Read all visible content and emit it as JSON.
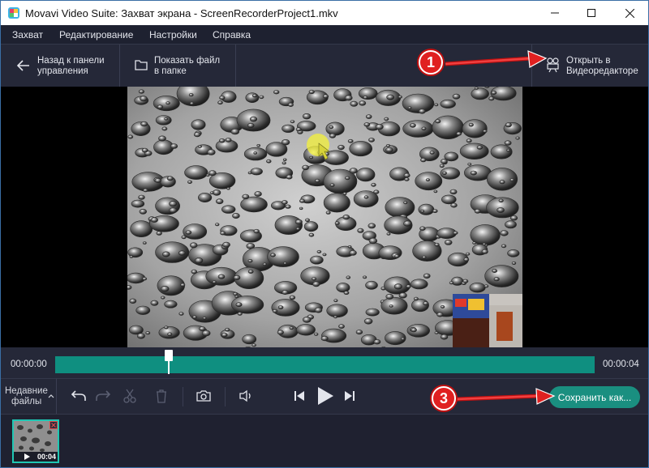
{
  "window": {
    "title": "Movavi Video Suite: Захват экрана - ScreenRecorderProject1.mkv",
    "controls": [
      "minimize-icon",
      "maximize-icon",
      "close-icon"
    ]
  },
  "menu": {
    "items": [
      "Захват",
      "Редактирование",
      "Настройки",
      "Справка"
    ]
  },
  "toolbar": {
    "back_label_1": "Назад к панели",
    "back_label_2": "управления",
    "show_file_label_1": "Показать файл",
    "show_file_label_2": "в папке",
    "open_editor_label_1": "Открыть в",
    "open_editor_label_2": "Видеоредакторе"
  },
  "timeline": {
    "current_time": "00:00:00",
    "duration": "00:00:04",
    "playhead_fraction": 0.21
  },
  "controls": {
    "recent_label_1": "Недавние",
    "recent_label_2": "файлы",
    "save_label": "Сохранить как...",
    "icons": [
      "undo-icon",
      "redo-icon",
      "cut-icon",
      "delete-icon",
      "snapshot-icon",
      "volume-icon",
      "prev-frame-icon",
      "play-icon",
      "next-frame-icon"
    ]
  },
  "recent_files": [
    {
      "duration": "00:04"
    }
  ],
  "annotations": {
    "badge_1": "1",
    "badge_3": "3"
  },
  "colors": {
    "accent": "#1a8f80",
    "track": "#0f8f80",
    "badge": "#e02020",
    "background": "#252838"
  }
}
